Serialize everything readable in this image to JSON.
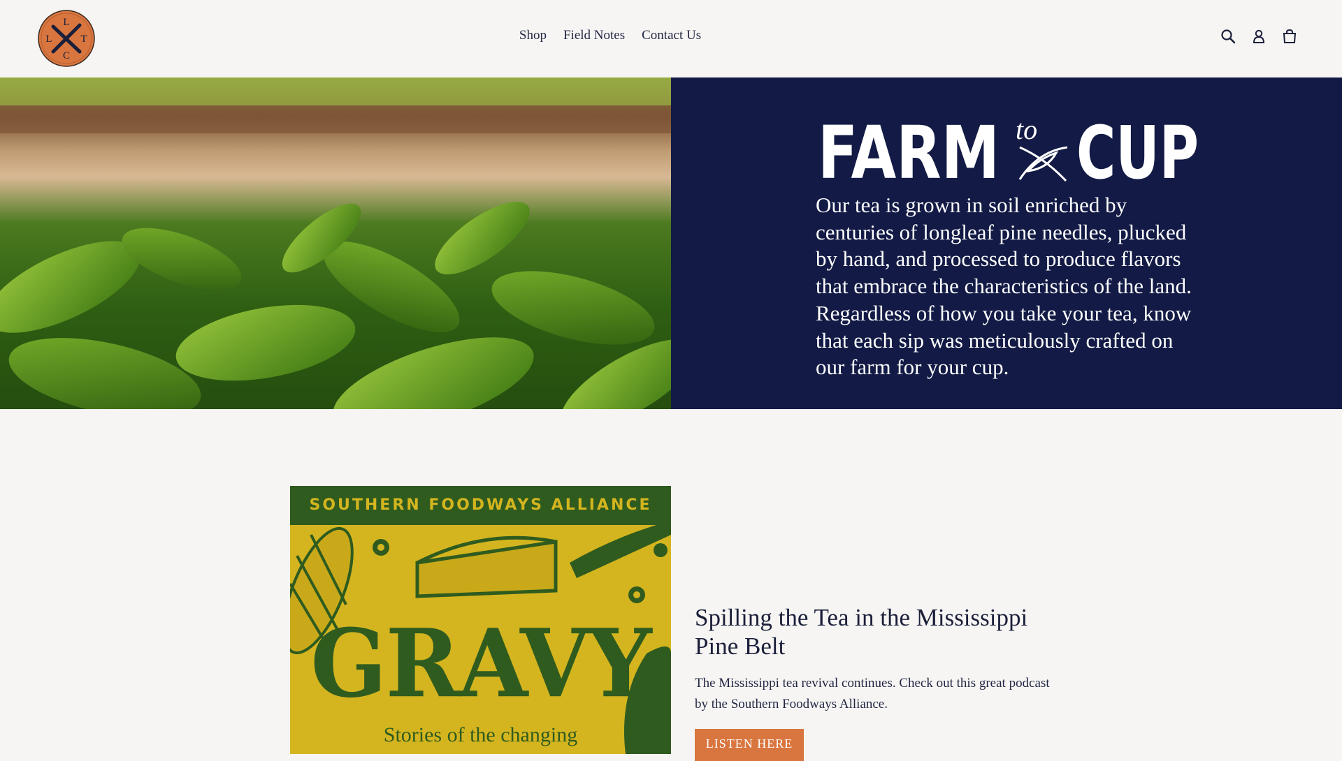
{
  "brand": {
    "logo_letters": [
      "L",
      "L",
      "T",
      "C"
    ],
    "accent_color": "#d9763f",
    "navy": "#121a45"
  },
  "header": {
    "nav": [
      {
        "label": "Shop"
      },
      {
        "label": "Field Notes"
      },
      {
        "label": "Contact Us"
      }
    ],
    "icons": [
      "search-icon",
      "account-icon",
      "cart-icon"
    ]
  },
  "hero": {
    "title_main": "FARM",
    "title_small": "to",
    "title_end": "CUP",
    "body": "Our tea is grown in soil enriched by centuries of longleaf pine needles, plucked by hand, and processed to produce flavors that embrace the characteristics of the land. Regardless of how you take your tea, know that each sip was meticulously crafted on our farm for your cup."
  },
  "feature": {
    "image": {
      "band_text": "SOUTHERN FOODWAYS ALLIANCE",
      "big_text": "GRAVY",
      "sub_text": "Stories of the changing"
    },
    "title": "Spilling the Tea in the Mississippi Pine Belt",
    "description": "The Mississippi tea revival continues. Check out this great podcast by the Southern Foodways Alliance.",
    "button_label": "LISTEN HERE"
  }
}
